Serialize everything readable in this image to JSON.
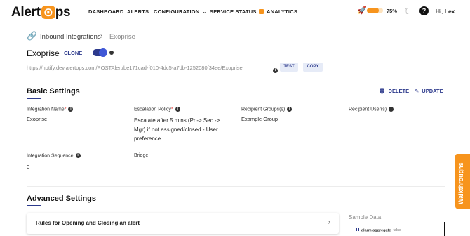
{
  "header": {
    "logo_text": "Alert",
    "logo_suffix": "ps",
    "nav": {
      "dashboard": "DASHBOARD",
      "alerts": "ALERTS",
      "configuration": "CONFIGURATION",
      "service_status": "SERVICE STATUS",
      "analytics": "ANALYTICS"
    },
    "progress_percent": 75,
    "progress_label": "75%",
    "greeting_prefix": "Hi, ",
    "user_name": "Lex"
  },
  "breadcrumb": {
    "parent": "Inbound Integrations",
    "current": "Exoprise"
  },
  "integration": {
    "title": "Exoprise",
    "clone_label": "CLONE",
    "enabled": true,
    "url": "https://notify.dev.alertops.com/POSTAlert/be171cad-f010-4dc5-a7db-1252080f34ee/Exoprise",
    "test_label": "TEST",
    "copy_label": "COPY"
  },
  "basic_settings": {
    "heading": "Basic Settings",
    "delete_label": "DELETE",
    "update_label": "UPDATE",
    "fields": {
      "integration_name_label": "Integration Name",
      "integration_name_value": "Exoprise",
      "escalation_policy_label": "Escalation Policy",
      "escalation_policy_value": "Escalate after 5 mins (Pri-> Sec -> Mgr) if not assigned/closed - User preference",
      "recipient_groups_label": "Recipient Groups(s)",
      "recipient_groups_value": "Example Group",
      "recipient_users_label": "Recipient User(s)",
      "integration_sequence_label": "Integration Sequence",
      "integration_sequence_value": "0",
      "bridge_label": "Bridge"
    }
  },
  "advanced_settings": {
    "heading": "Advanced Settings",
    "rules_label": "Rules for Opening and Closing an alert",
    "sample_data_label": "Sample Data",
    "sample_key": "alarm.aggregate",
    "sample_value": "false"
  },
  "walkthroughs_label": "Walkthroughs",
  "colors": {
    "brand_orange": "#f7941d",
    "accent_navy": "#2d3a8c"
  }
}
